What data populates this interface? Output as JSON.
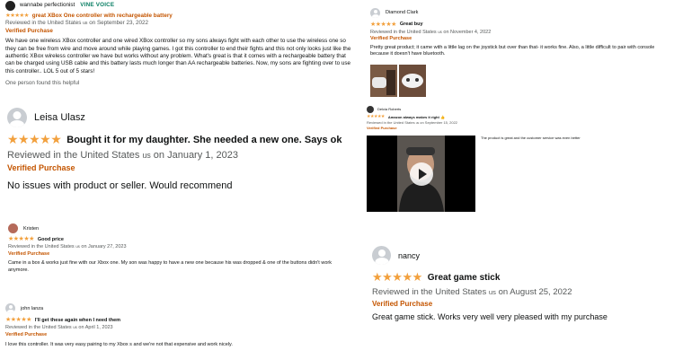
{
  "colors": {
    "star": "#f2a03d",
    "verified": "#c45500",
    "vine": "#067d62",
    "meta": "#565959"
  },
  "reviews": [
    {
      "author": "wannabe perfectionist",
      "badge": "VINE VOICE",
      "stars": "★★★★★",
      "title": "great XBox One controller with rechargeable battery",
      "reviewed_prefix": "Reviewed in the United States",
      "country_code": "us",
      "date": "on September 23, 2022",
      "verified": "Verified Purchase",
      "body": "We have one wireless XBox controller and one wired XBox controller so my sons always fight with each other to use the wireless one so they can be free from wire and move around while playing games. I got this controller to end their fights and this not only looks just like the authentic XBox wireless controller we have but works without any problem. What's great is that it comes with a rechargeable battery that can be charged using USB cable and this battery lasts much longer than AA rechargeable batteries. Now, my sons are fighting over to use this controller.. LOL 5 out of 5 stars!",
      "helpful": "One person found this helpful"
    },
    {
      "author": "Leisa Ulasz",
      "stars": "★★★★★",
      "title": "Bought it for my daughter. She needed a new one. Says ok",
      "reviewed_prefix": "Reviewed in the United States",
      "country_code": "us",
      "date": "on January 1, 2023",
      "verified": "Verified Purchase",
      "body": "No issues with product or seller. Would recommend"
    },
    {
      "author": "Kristen",
      "stars": "★★★★★",
      "title": "Good price",
      "reviewed_prefix": "Reviewed in the United States",
      "country_code": "us",
      "date": "on January 27, 2023",
      "verified": "Verified Purchase",
      "body": "Came in a box & works just fine with our Xbox one. My son was happy to have a new one because his was dropped & one of the buttons didn't work anymore."
    },
    {
      "author": "john lanza",
      "stars": "★★★★★",
      "title": "I'll get these again when I need them",
      "reviewed_prefix": "Reviewed in the United States",
      "country_code": "us",
      "date": "on April 1, 2023",
      "verified": "Verified Purchase",
      "body": "I love this controller. It was very easy pairing to my Xbox s and we're not that expensive and work nicely."
    },
    {
      "author": "Diamond Clark",
      "stars": "★★★★★",
      "title": "Great buy",
      "reviewed_prefix": "Reviewed in the United States",
      "country_code": "us",
      "date": "on November 4, 2022",
      "verified": "Verified Purchase",
      "body": "Pretty great product; it came with a little lag on the joystick but over than that- it works fine. Also, a little difficult to pair with console because it doesn't have bluetooth."
    },
    {
      "author": "Delcia Roberts",
      "stars": "★★★★★",
      "title": "Amazon always makes it right 👍",
      "reviewed_prefix": "Reviewed in the United States",
      "country_code": "us",
      "date": "on September 15, 2022",
      "verified": "Verified Purchase",
      "body": "The product is great and the customer service was even better"
    },
    {
      "author": "nancy",
      "stars": "★★★★★",
      "title": "Great game stick",
      "reviewed_prefix": "Reviewed in the United States",
      "country_code": "us",
      "date": "on August 25, 2022",
      "verified": "Verified Purchase",
      "body": "Great game stick. Works very well very pleased with my purchase"
    }
  ]
}
